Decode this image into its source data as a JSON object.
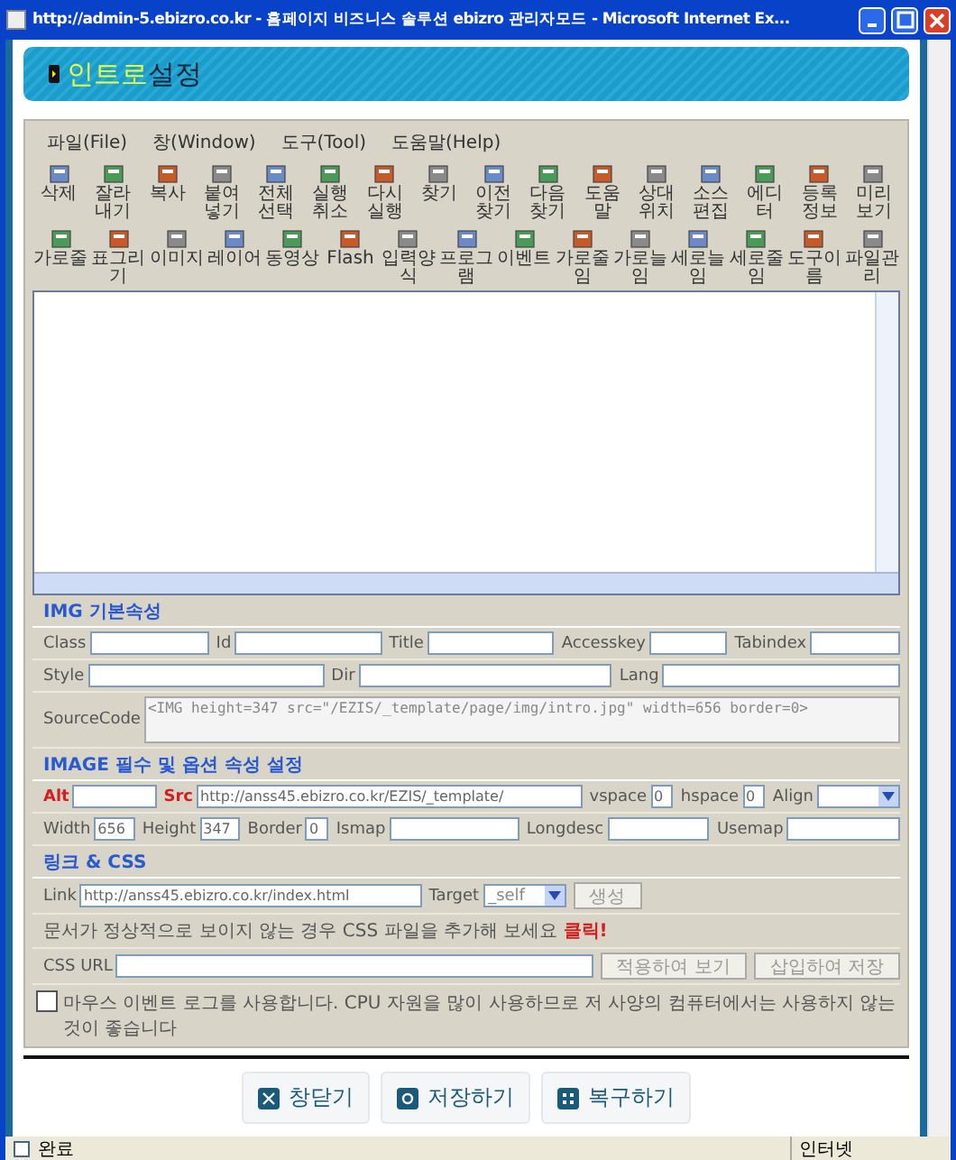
{
  "window": {
    "title": "http://admin-5.ebizro.co.kr - 홈페이지 비즈니스 솔루션 ebizro 관리자모드 - Microsoft Internet Ex..."
  },
  "header": {
    "accent": "인트로",
    "title": "설정"
  },
  "menu": [
    "파일(File)",
    "창(Window)",
    "도구(Tool)",
    "도움말(Help)"
  ],
  "toolbar": [
    [
      "삭제",
      "잘라내기",
      "복사",
      "붙여넣기",
      "전체선택",
      "실행취소",
      "다시실행",
      "찾기",
      "이전찾기",
      "다음찾기",
      "도움말",
      "상대위치",
      "소스편집",
      "에디터",
      "등록정보",
      "미리보기"
    ],
    [
      "가로줄",
      "표그리기",
      "이미지",
      "레이어",
      "동영상",
      "Flash",
      "입력양식",
      "프로그램",
      "이벤트",
      "가로줄임",
      "가로늘임",
      "세로늘임",
      "세로줄임",
      "도구이름",
      "파일관리"
    ]
  ],
  "sections": [
    {
      "title": "IMG 기본속성",
      "lines": [
        {
          "fields": [
            {
              "kind": "input",
              "label": "Class",
              "required": false
            },
            {
              "kind": "input",
              "label": "Id",
              "required": false
            },
            {
              "kind": "input",
              "label": "Title",
              "required": false
            },
            {
              "kind": "input",
              "label": "Accesskey",
              "required": false
            },
            {
              "kind": "input",
              "label": "Tabindex",
              "required": false
            }
          ]
        },
        {
          "fields": [
            {
              "kind": "input",
              "label": "Style",
              "required": false
            },
            {
              "kind": "input",
              "label": "Dir",
              "required": false
            },
            {
              "kind": "input",
              "label": "Lang",
              "required": false
            }
          ]
        },
        {
          "fields": [
            {
              "kind": "textarea",
              "label": "SourceCode",
              "required": false,
              "value": "<IMG height=347 src=\"/EZIS/_template/page/img/intro.jpg\" width=656 border=0>"
            }
          ]
        }
      ]
    },
    {
      "title": "IMAGE 필수 및 옵션 속성 설정",
      "lines": [
        {
          "fields": [
            {
              "kind": "input",
              "label": "Alt",
              "required": true
            },
            {
              "kind": "input",
              "label": "Src",
              "required": true,
              "value": "http://anss45.ebizro.co.kr/EZIS/_template/"
            },
            {
              "kind": "input",
              "label": "vspace",
              "required": false,
              "value": "0"
            },
            {
              "kind": "input",
              "label": "hspace",
              "required": false,
              "value": "0"
            },
            {
              "kind": "select",
              "label": "Align",
              "required": false
            }
          ]
        },
        {
          "fields": [
            {
              "kind": "input",
              "label": "Width",
              "required": false,
              "value": "656"
            },
            {
              "kind": "input",
              "label": "Height",
              "required": false,
              "value": "347"
            },
            {
              "kind": "input",
              "label": "Border",
              "required": false,
              "value": "0"
            },
            {
              "kind": "input",
              "label": "Ismap",
              "required": false
            },
            {
              "kind": "input",
              "label": "Longdesc",
              "required": false
            },
            {
              "kind": "input",
              "label": "Usemap",
              "required": false
            }
          ]
        }
      ]
    },
    {
      "title": "링크 & CSS",
      "lines": [
        {
          "fields": [
            {
              "kind": "input",
              "label": "Link",
              "required": false,
              "value": "http://anss45.ebizro.co.kr/index.html"
            },
            {
              "kind": "select",
              "label": "Target",
              "required": false,
              "value": "_self"
            },
            {
              "kind": "button",
              "text": "생성"
            }
          ]
        },
        {
          "fields": [
            {
              "kind": "notice",
              "text": "문서가 정상적으로 보이지 않는 경우 CSS 파일을 추가해 보세요",
              "link": "클릭!"
            }
          ]
        },
        {
          "fields": [
            {
              "kind": "input",
              "label": "CSS URL",
              "required": false
            },
            {
              "kind": "button",
              "text": "적용하여 보기"
            },
            {
              "kind": "button",
              "text": "삽입하여 저장"
            }
          ]
        }
      ]
    }
  ],
  "option": {
    "label": "마우스 이벤트 로그를 사용합니다. CPU 자원을 많이 사용하므로 저 사양의 컴퓨터에서는 사용하지 않는 것이 좋습니다",
    "checked": false
  },
  "buttons": [
    {
      "kind": "close",
      "label": "창닫기"
    },
    {
      "kind": "save",
      "label": "저장하기"
    },
    {
      "kind": "restore",
      "label": "복구하기"
    }
  ],
  "status_bar": {
    "text": "완료",
    "zone": "인터넷"
  }
}
